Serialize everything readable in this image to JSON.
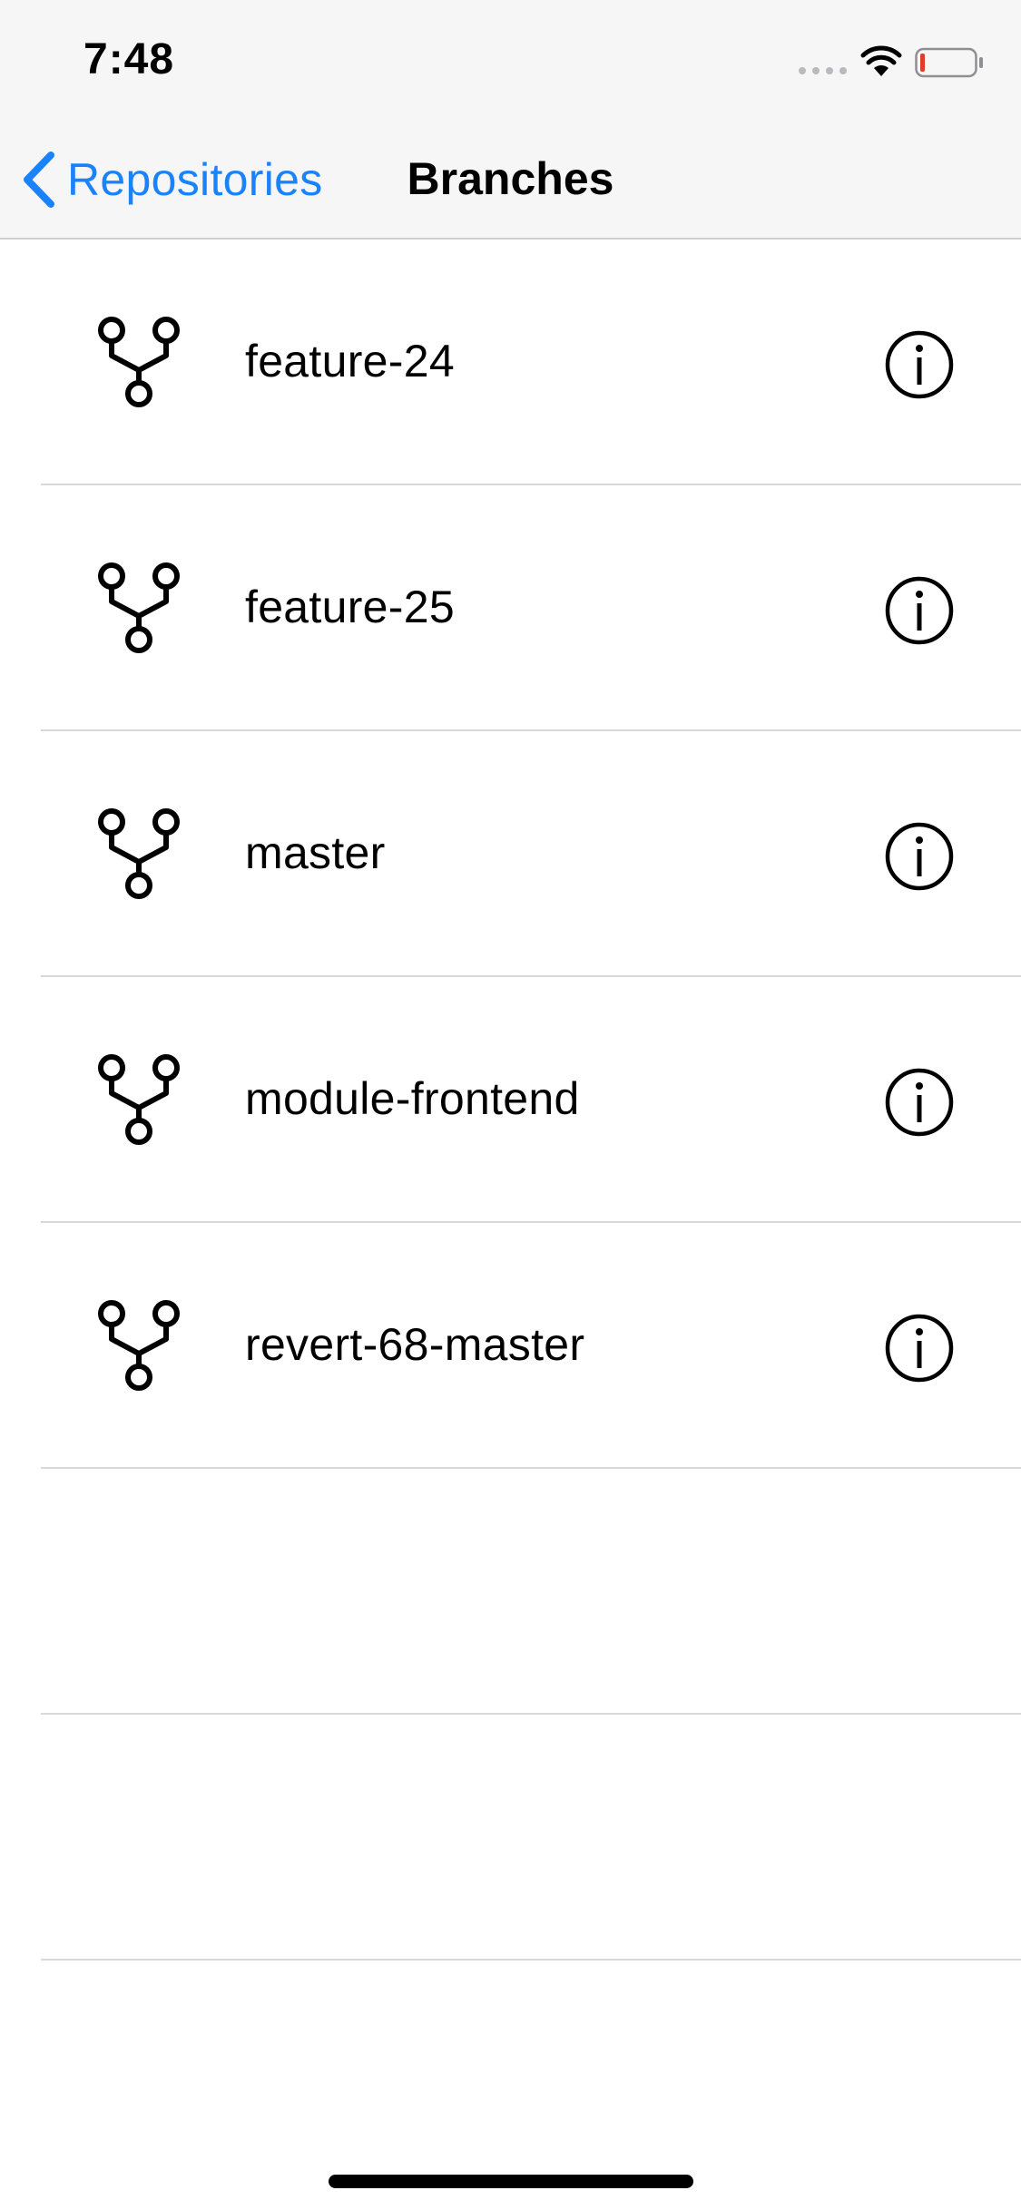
{
  "status_bar": {
    "time": "7:48",
    "battery_color": "#e23b2e"
  },
  "nav": {
    "back_label": "Repositories",
    "title": "Branches",
    "accent_color": "#1a82fb"
  },
  "branches": [
    {
      "name": "feature-24",
      "icon": "branch-icon",
      "accessory": "info-icon"
    },
    {
      "name": "feature-25",
      "icon": "branch-icon",
      "accessory": "info-icon"
    },
    {
      "name": "master",
      "icon": "branch-icon",
      "accessory": "info-icon"
    },
    {
      "name": "module-frontend",
      "icon": "branch-icon",
      "accessory": "info-icon"
    },
    {
      "name": "revert-68-master",
      "icon": "branch-icon",
      "accessory": "info-icon"
    }
  ]
}
